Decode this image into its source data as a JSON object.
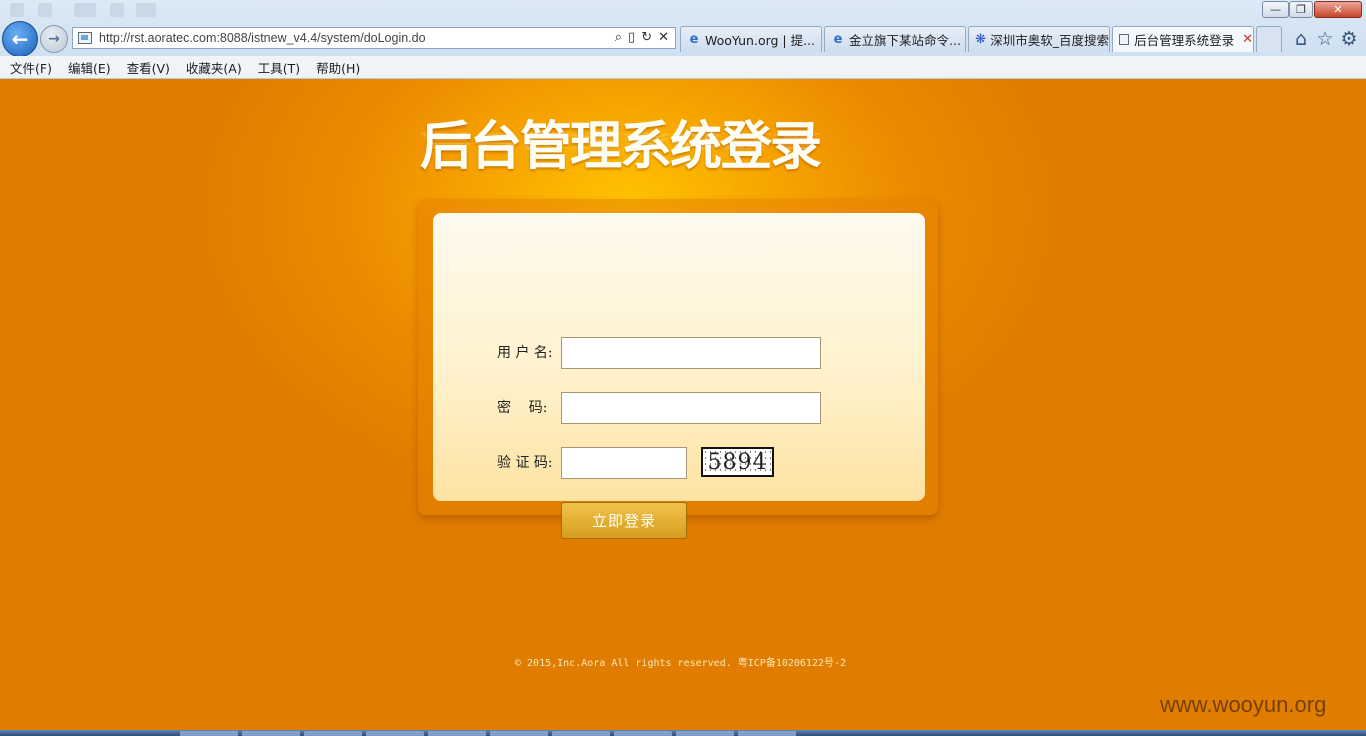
{
  "browser": {
    "url": "http://rst.aoratec.com:8088/istnew_v4.4/system/doLogin.do",
    "tabs": [
      {
        "label": "WooYun.org | 提...",
        "icon": "ie-icon"
      },
      {
        "label": "金立旗下某站命令...",
        "icon": "ie-icon"
      },
      {
        "label": "深圳市奥软_百度搜索",
        "icon": "baidu-icon"
      },
      {
        "label": "后台管理系统登录",
        "icon": "page-icon"
      }
    ],
    "menu": [
      "文件(F)",
      "编辑(E)",
      "查看(V)",
      "收藏夹(A)",
      "工具(T)",
      "帮助(H)"
    ],
    "controls": {
      "minimize": "—",
      "restore": "❐",
      "close": "✕"
    },
    "addr_tools": {
      "search": "⌕",
      "compat": "▯",
      "refresh": "↻",
      "stop": "✕"
    },
    "tab_close": "✕",
    "nav": {
      "back": "←",
      "forward": "→"
    },
    "toolbar_icons": {
      "home": "⌂",
      "favorites": "☆",
      "tools": "⚙"
    }
  },
  "login": {
    "title": "后台管理系统登录",
    "username_label": "用 户 名:",
    "password_label": "密    码:",
    "captcha_label": "验 证 码:",
    "captcha_text": "5894",
    "username_value": "",
    "password_value": "",
    "captcha_value": "",
    "submit_label": "立即登录"
  },
  "footer": {
    "copyright": "© 2015,Inc.Aora All rights reserved.  粤ICP备10206122号-2"
  },
  "watermark": "www.wooyun.org",
  "colors": {
    "background": "#e07d00",
    "glow": "#ffc400",
    "panel": "#fff2cd",
    "button": "#d79e1f"
  }
}
